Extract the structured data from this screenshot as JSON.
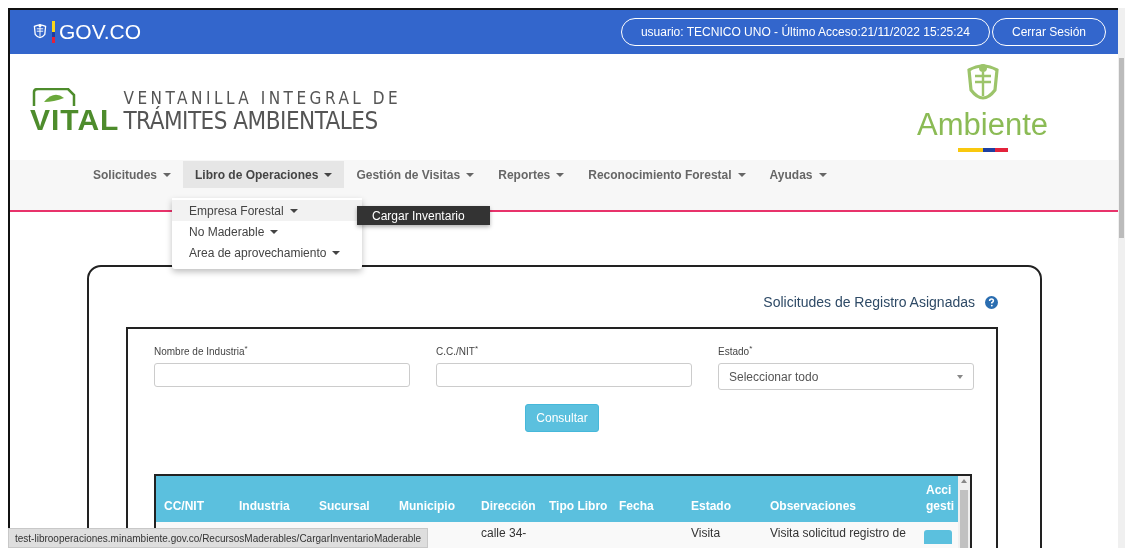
{
  "header": {
    "brand": "GOV.CO",
    "user_info": "usuario: TECNICO UNO - Último Acceso:21/11/2022 15:25:24",
    "logout": "Cerrar Sesión"
  },
  "logo": {
    "vital": "VITAL",
    "line1": "VENTANILLA INTEGRAL DE",
    "line2": "TRÁMITES AMBIENTALES",
    "ministry": "Ambiente"
  },
  "nav": [
    {
      "label": "Solicitudes",
      "selected": false
    },
    {
      "label": "Libro de Operaciones",
      "selected": true
    },
    {
      "label": "Gestión de Visitas",
      "selected": false
    },
    {
      "label": "Reportes",
      "selected": false
    },
    {
      "label": "Reconocimiento Forestal",
      "selected": false
    },
    {
      "label": "Ayudas",
      "selected": false
    }
  ],
  "dropdown": {
    "items": [
      {
        "label": "Empresa Forestal",
        "highlighted": true
      },
      {
        "label": "No Maderable",
        "highlighted": false
      },
      {
        "label": "Area de aprovechamiento",
        "highlighted": false
      }
    ],
    "submenu": [
      "Cargar Inventario"
    ]
  },
  "panel": {
    "title": "Solicitudes de Registro Asignadas",
    "fields": [
      {
        "kind": "text",
        "label": "Nombre de Industria$^{*}$"
      },
      {
        "kind": "text",
        "label": "C.C./NIT$^{*}$"
      },
      {
        "kind": "select",
        "label": "Estado$^{*}$",
        "value": "Seleccionar todo"
      }
    ],
    "submit": "Consultar"
  },
  "table": {
    "columns": [
      "CC/NIT",
      "Industria",
      "Sucursal",
      "Municipio",
      "Dirección",
      "Tipo Libro",
      "Fecha",
      "Estado",
      "Observaciones",
      "Acci gesti"
    ],
    "rows": [
      {
        "cells": [
          {
            "kind": "empty"
          },
          {
            "kind": "empty"
          },
          {
            "kind": "empty"
          },
          {
            "kind": "empty"
          },
          {
            "kind": "text",
            "text": "calle 34-"
          },
          {
            "kind": "empty"
          },
          {
            "kind": "empty"
          },
          {
            "kind": "text",
            "text": "Visita"
          },
          {
            "kind": "text",
            "text": "Visita solicitud registro de"
          },
          {
            "kind": "button"
          }
        ]
      }
    ]
  },
  "status_url": "test-librooperaciones.minambiente.gov.co/RecursosMaderables/CargarInventarioMaderable"
}
